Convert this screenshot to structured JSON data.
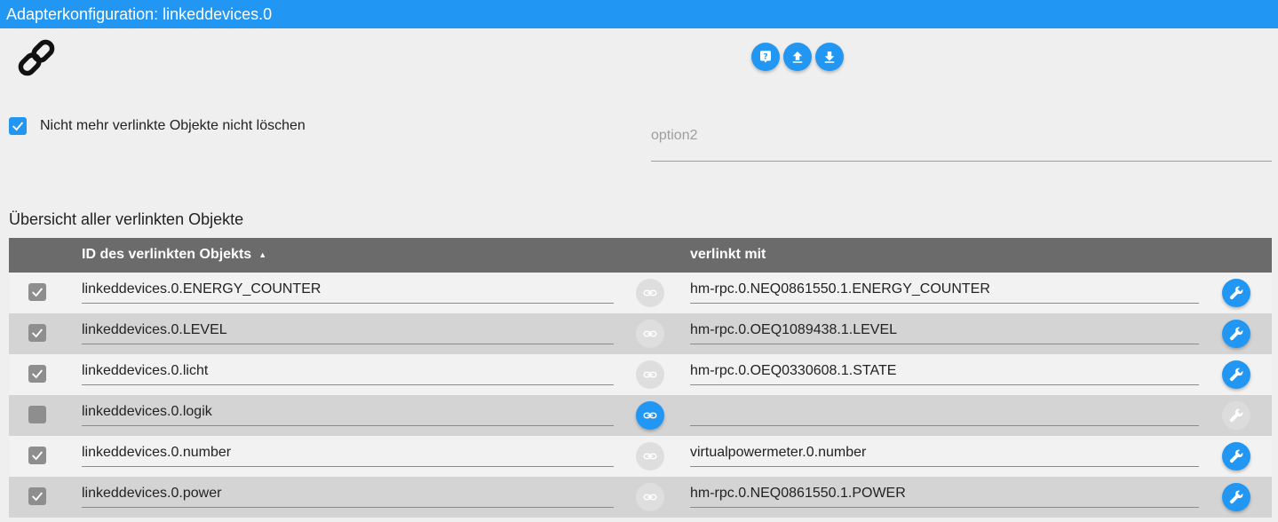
{
  "window": {
    "title": "Adapterkonfiguration: linkeddevices.0"
  },
  "toolbar": {
    "icons": [
      "help-icon",
      "upload-icon",
      "download-icon"
    ]
  },
  "options": {
    "keep_objects_label": "Nicht mehr verlinkte Objekte nicht löschen",
    "keep_objects_checked": true,
    "option2_placeholder": "option2",
    "option2_value": ""
  },
  "section": {
    "title": "Übersicht aller verlinkten Objekte"
  },
  "table": {
    "columns": {
      "id": "ID des verlinkten Objekts",
      "sort_indicator": "▲",
      "linked_with": "verlinkt mit"
    },
    "rows": [
      {
        "id": "linkeddevices.0.ENERGY_COUNTER",
        "target": "hm-rpc.0.NEQ0861550.1.ENERGY_COUNTER",
        "checked": true,
        "link_active": false,
        "wrench_enabled": true
      },
      {
        "id": "linkeddevices.0.LEVEL",
        "target": "hm-rpc.0.OEQ1089438.1.LEVEL",
        "checked": true,
        "link_active": false,
        "wrench_enabled": true
      },
      {
        "id": "linkeddevices.0.licht",
        "target": "hm-rpc.0.OEQ0330608.1.STATE",
        "checked": true,
        "link_active": false,
        "wrench_enabled": true
      },
      {
        "id": "linkeddevices.0.logik",
        "target": "",
        "checked": false,
        "link_active": true,
        "wrench_enabled": false
      },
      {
        "id": "linkeddevices.0.number",
        "target": "virtualpowermeter.0.number",
        "checked": true,
        "link_active": false,
        "wrench_enabled": true
      },
      {
        "id": "linkeddevices.0.power",
        "target": "hm-rpc.0.NEQ0861550.1.POWER",
        "checked": true,
        "link_active": false,
        "wrench_enabled": true
      }
    ]
  },
  "colors": {
    "accent": "#2196f3",
    "header_bg": "#6b6b6b"
  }
}
